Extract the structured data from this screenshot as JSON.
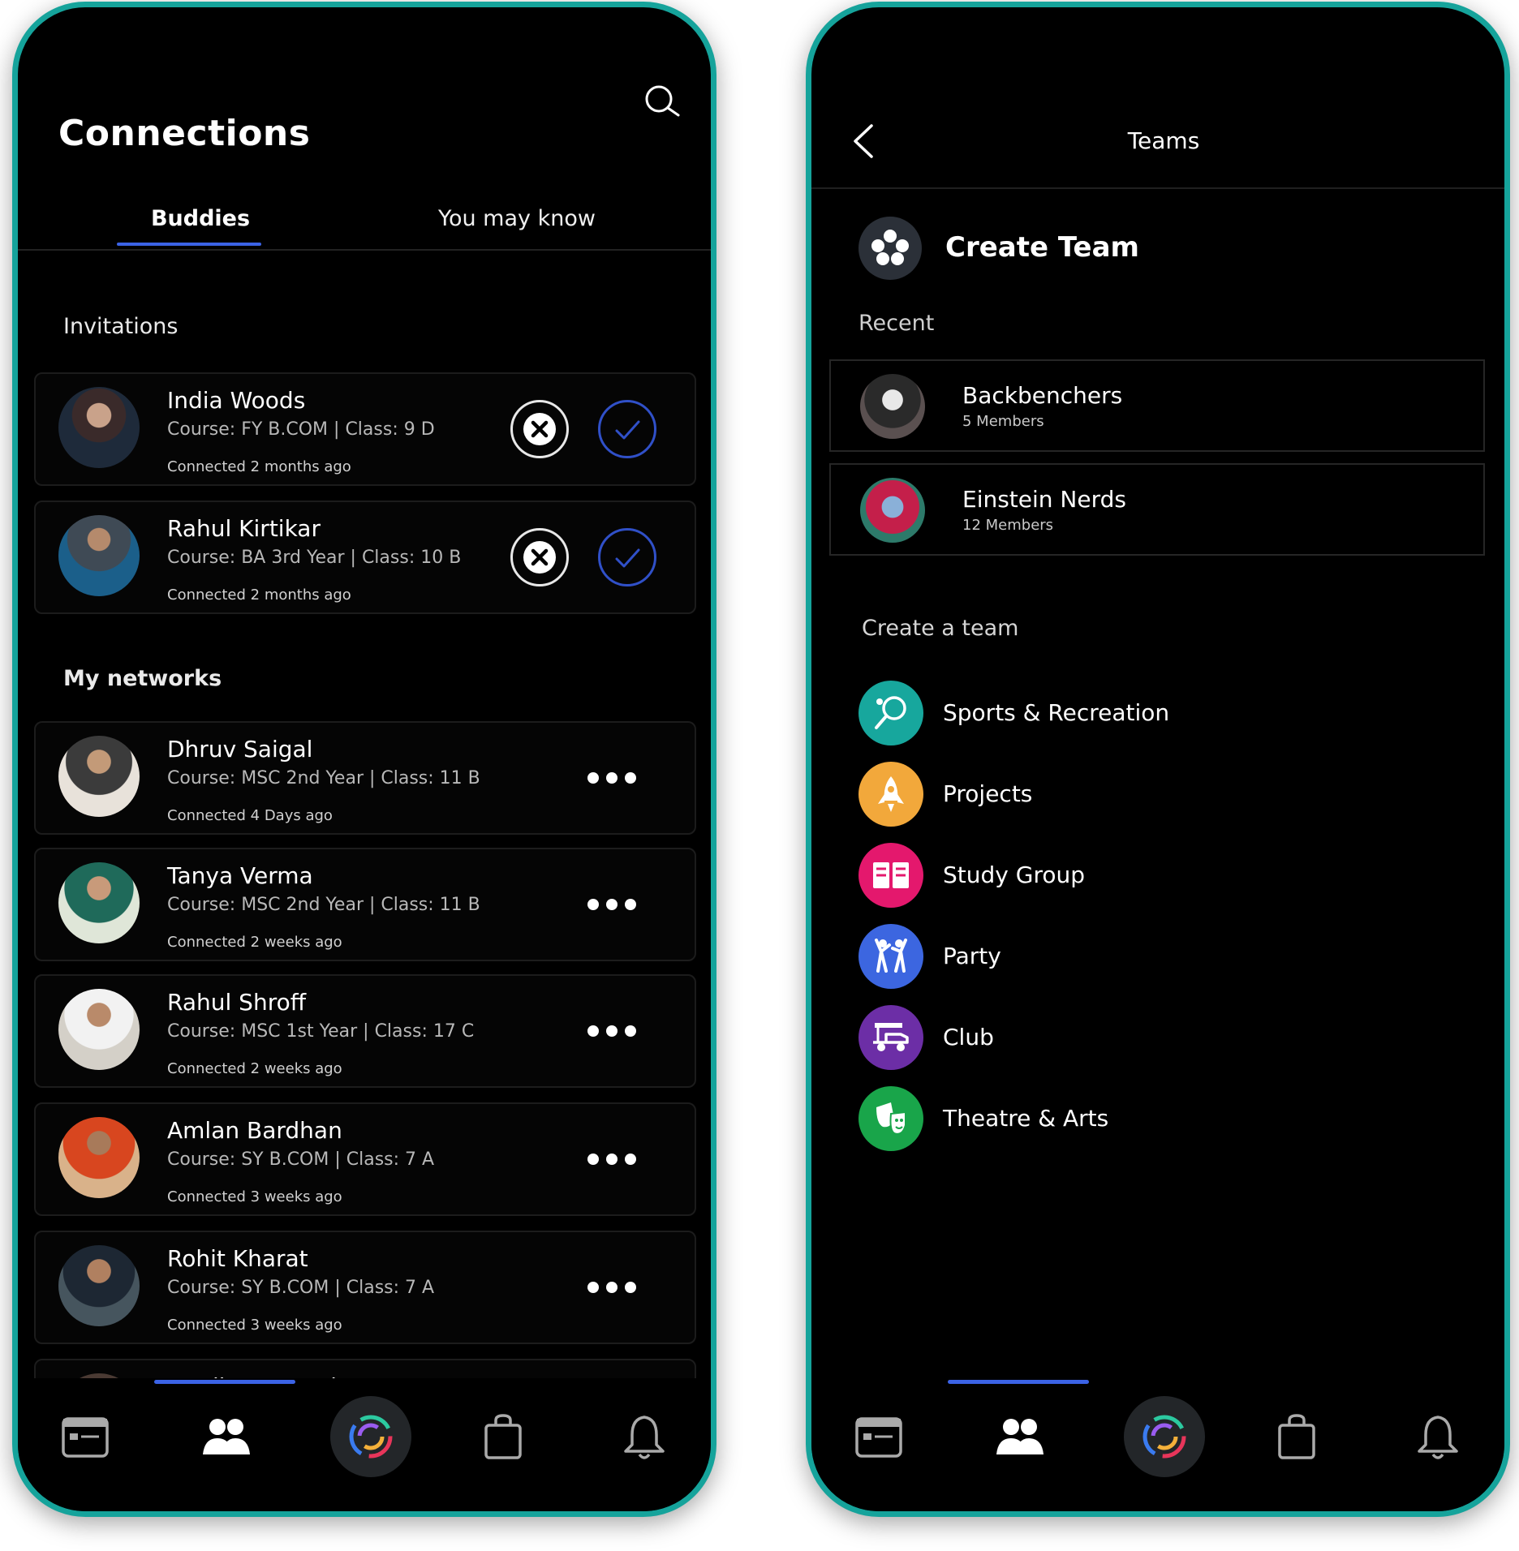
{
  "left": {
    "title": "Connections",
    "tabs": {
      "buddies": "Buddies",
      "you_may_know": "You may know"
    },
    "invitations_heading": "Invitations",
    "invitations": [
      {
        "name": "India Woods",
        "course": "Course: FY B.COM | Class: 9 D",
        "connected": "Connected 2 months ago"
      },
      {
        "name": "Rahul Kirtikar",
        "course": "Course: BA 3rd Year | Class: 10 B",
        "connected": "Connected 2 months ago"
      }
    ],
    "networks_heading": "My networks",
    "networks": [
      {
        "name": "Dhruv Saigal",
        "course": "Course: MSC 2nd Year | Class: 11 B",
        "connected": "Connected 4 Days ago"
      },
      {
        "name": "Tanya Verma",
        "course": "Course: MSC 2nd Year | Class: 11 B",
        "connected": "Connected 2 weeks ago"
      },
      {
        "name": "Rahul Shroff",
        "course": "Course: MSC 1st Year | Class: 17 C",
        "connected": "Connected 2 weeks ago"
      },
      {
        "name": "Amlan Bardhan",
        "course": "Course: SY B.COM | Class: 7 A",
        "connected": "Connected 3 weeks ago"
      },
      {
        "name": "Rohit Kharat",
        "course": "Course: SY B.COM | Class: 7 A",
        "connected": "Connected 3 weeks ago"
      },
      {
        "name": "Hanika Paryani"
      }
    ]
  },
  "right": {
    "title": "Teams",
    "create_team": "Create Team",
    "recent_heading": "Recent",
    "recent": [
      {
        "name": "Backbenchers",
        "members": "5 Members"
      },
      {
        "name": "Einstein Nerds",
        "members": "12 Members"
      }
    ],
    "create_heading": "Create a team",
    "categories": [
      {
        "label": "Sports & Recreation",
        "color": "#17a79d",
        "icon": "ping-pong-icon"
      },
      {
        "label": "Projects",
        "color": "#f2a83b",
        "icon": "rocket-icon"
      },
      {
        "label": "Study Group",
        "color": "#e4186d",
        "icon": "book-icon"
      },
      {
        "label": "Party",
        "color": "#3c66e0",
        "icon": "party-people-icon"
      },
      {
        "label": "Club",
        "color": "#6c2ea6",
        "icon": "golf-cart-icon"
      },
      {
        "label": "Theatre & Arts",
        "color": "#19a54a",
        "icon": "theatre-mask-icon"
      }
    ]
  },
  "colors": {
    "accent": "#3b63e6",
    "frame": "#15a39b",
    "background": "#000000"
  }
}
